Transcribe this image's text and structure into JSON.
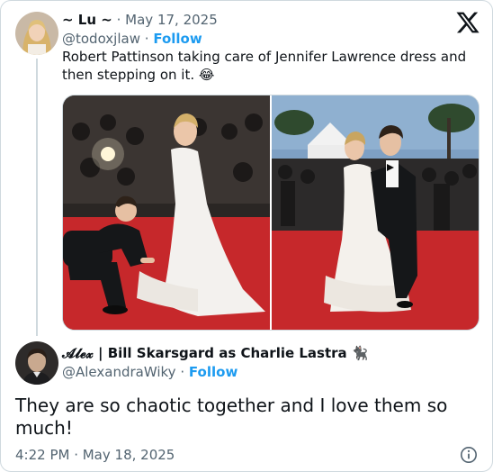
{
  "quoted_tweet": {
    "display_name": "~ Lu ~",
    "date": "May 17, 2025",
    "handle": "@todoxjlaw",
    "follow_label": "Follow",
    "text": "Robert Pattinson taking care of Jennifer Lawrence dress and then stepping on it. 😂",
    "avatar_icon": "avatar-woman-blonde",
    "media": [
      {
        "icon": "red-carpet-photo-kneeling"
      },
      {
        "icon": "red-carpet-photo-posing"
      }
    ]
  },
  "main_tweet": {
    "display_name": "𝓐𝓵𝓮𝔁 | Bill Skarsgard as Charlie Lastra 🐈‍⬛",
    "handle": "@AlexandraWiky",
    "follow_label": "Follow",
    "text": "They are so chaotic together and I love them so much!",
    "timestamp": "4:22 PM · May 18, 2025",
    "avatar_icon": "avatar-man-dark"
  },
  "separator": "·",
  "brand": {
    "logo_icon": "x-logo-icon",
    "color": "#0f1419"
  },
  "colors": {
    "link": "#1d9bf0",
    "muted": "#536471",
    "carpet": "#c6282b"
  }
}
